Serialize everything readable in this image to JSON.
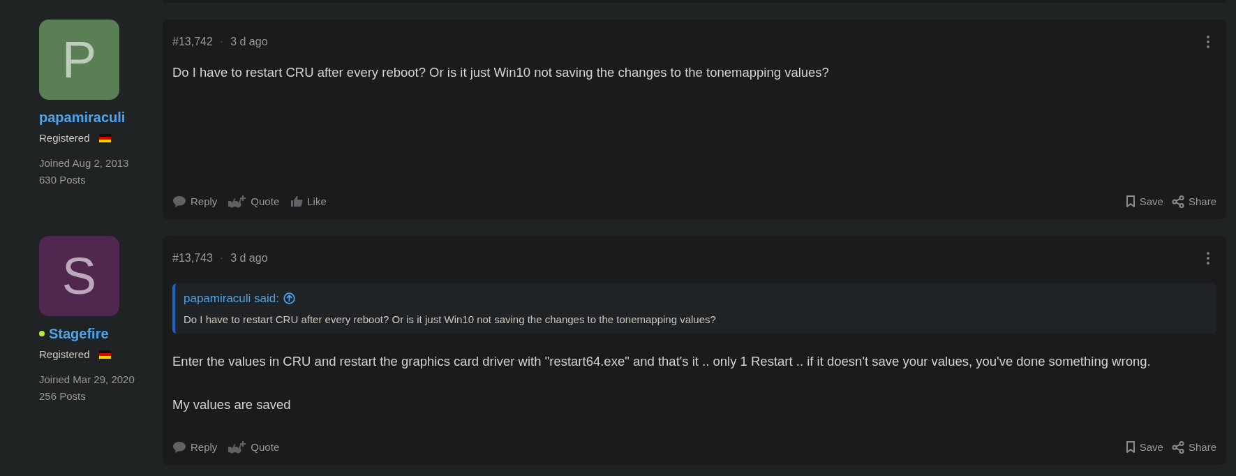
{
  "posts": [
    {
      "author": {
        "initial": "P",
        "color": "#5b7f55",
        "name": "papamiraculi",
        "online": false,
        "role": "Registered",
        "joined": "Joined Aug 2, 2013",
        "posts": "630 Posts"
      },
      "number": "#13,742",
      "separator": "·",
      "time": "3 d ago",
      "paragraphs": [
        "Do I have to restart CRU after every reboot? Or is it just Win10 not saving the changes to the tonemapping values?"
      ],
      "actions": [
        {
          "kind": "reply",
          "label": "Reply"
        },
        {
          "kind": "quote",
          "label": "Quote"
        },
        {
          "kind": "like",
          "label": "Like"
        }
      ],
      "tools": [
        {
          "kind": "save",
          "label": "Save"
        },
        {
          "kind": "share",
          "label": "Share"
        }
      ]
    },
    {
      "author": {
        "initial": "S",
        "color": "#50284f",
        "name": "Stagefire",
        "online": true,
        "role": "Registered",
        "joined": "Joined Mar 29, 2020",
        "posts": "256 Posts"
      },
      "number": "#13,743",
      "separator": "·",
      "time": "3 d ago",
      "quote": {
        "source": "papamiraculi said:",
        "text": "Do I have to restart CRU after every reboot? Or is it just Win10 not saving the changes to the tonemapping values?"
      },
      "paragraphs": [
        "Enter the values in CRU and restart the graphics card driver with \"restart64.exe\" and that's it .. only 1 Restart .. if it doesn't save your values, you've done something wrong.",
        "My values are saved"
      ],
      "actions": [
        {
          "kind": "reply",
          "label": "Reply"
        },
        {
          "kind": "quote",
          "label": "Quote"
        }
      ],
      "tools": [
        {
          "kind": "save",
          "label": "Save"
        },
        {
          "kind": "share",
          "label": "Share"
        }
      ]
    }
  ]
}
